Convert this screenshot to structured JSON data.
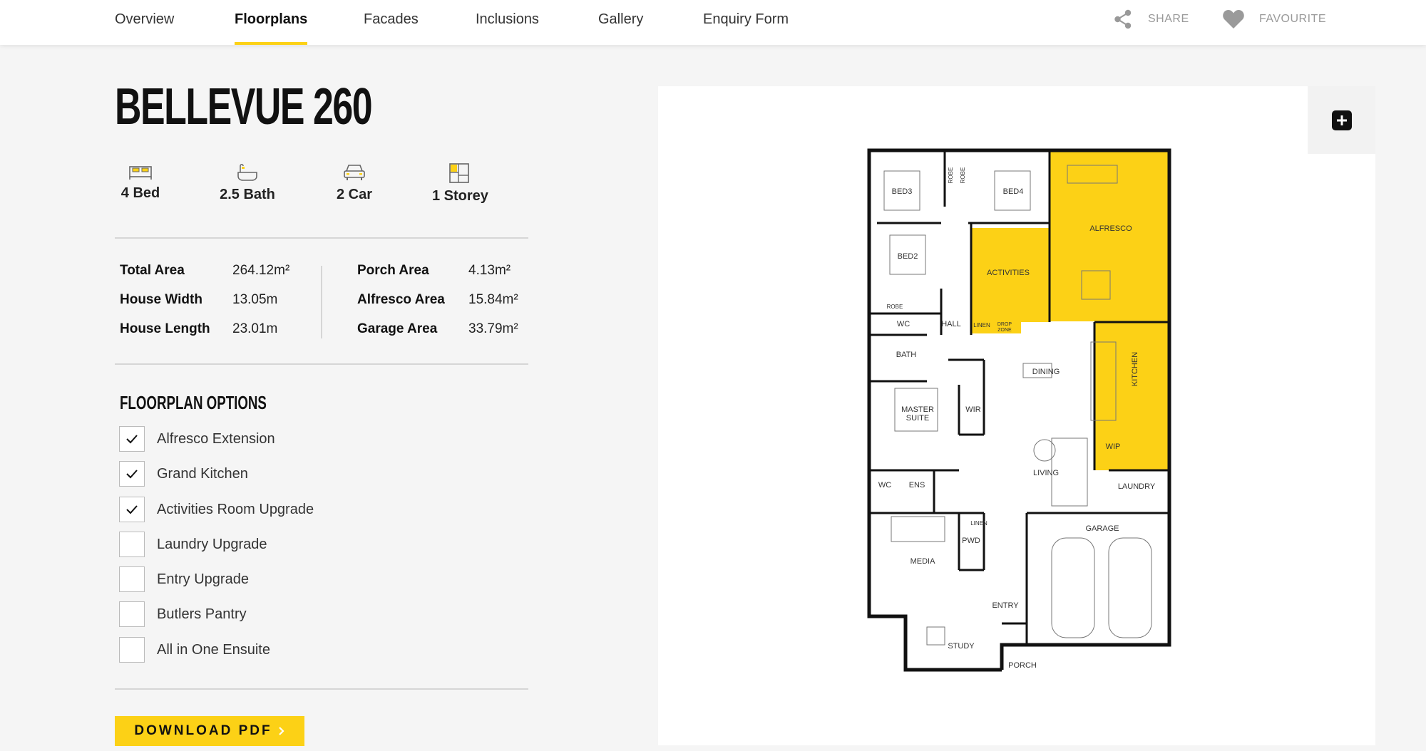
{
  "nav": {
    "tabs": [
      {
        "label": "Overview",
        "active": false
      },
      {
        "label": "Floorplans",
        "active": true
      },
      {
        "label": "Facades",
        "active": false
      },
      {
        "label": "Inclusions",
        "active": false
      },
      {
        "label": "Gallery",
        "active": false
      },
      {
        "label": "Enquiry Form",
        "active": false
      }
    ],
    "share": {
      "label": "SHARE",
      "icon": "share-icon"
    },
    "favourite": {
      "label": "FAVOURITE",
      "icon": "heart-icon"
    }
  },
  "home": {
    "title": "BELLEVUE 260",
    "specs": [
      {
        "icon": "bed-icon",
        "label": "4 Bed"
      },
      {
        "icon": "bath-icon",
        "label": "2.5 Bath"
      },
      {
        "icon": "car-icon",
        "label": "2 Car"
      },
      {
        "icon": "storey-icon",
        "label": "1 Storey"
      }
    ],
    "areas_left": [
      {
        "label": "Total Area",
        "value": "264.12m²"
      },
      {
        "label": "House Width",
        "value": "13.05m"
      },
      {
        "label": "House Length",
        "value": "23.01m"
      }
    ],
    "areas_right": [
      {
        "label": "Porch Area",
        "value": "4.13m²"
      },
      {
        "label": "Alfresco Area",
        "value": "15.84m²"
      },
      {
        "label": "Garage Area",
        "value": "33.79m²"
      }
    ]
  },
  "options": {
    "title": "FLOORPLAN OPTIONS",
    "items": [
      {
        "label": "Alfresco Extension",
        "checked": true
      },
      {
        "label": "Grand Kitchen",
        "checked": true
      },
      {
        "label": "Activities Room Upgrade",
        "checked": true
      },
      {
        "label": "Laundry Upgrade",
        "checked": false
      },
      {
        "label": "Entry Upgrade",
        "checked": false
      },
      {
        "label": "Butlers Pantry",
        "checked": false
      },
      {
        "label": "All in One Ensuite",
        "checked": false
      }
    ]
  },
  "download": {
    "label": "DOWNLOAD PDF"
  },
  "plan": {
    "highlight_color": "#fcd116",
    "zoom_icon": "plus-icon",
    "rooms": {
      "bed3": "BED3",
      "bed4": "BED4",
      "robe_a": "ROBE",
      "robe_b": "ROBE",
      "alfresco": "ALFRESCO",
      "bed2": "BED2",
      "activities": "ACTIVITIES",
      "robe_c": "ROBE",
      "wc1": "WC",
      "hall": "HALL",
      "linen1": "LINEN",
      "drop1": "DROP",
      "drop2": "ZONE",
      "bath": "BATH",
      "dining": "DINING",
      "kitchen": "KITCHEN",
      "master1": "MASTER",
      "master2": "SUITE",
      "wir": "WIR",
      "wip": "WIP",
      "living": "LIVING",
      "laundry": "LAUNDRY",
      "wc2": "WC",
      "ens": "ENS",
      "linen2": "LINEN",
      "garage": "GARAGE",
      "pwd": "PWD",
      "media": "MEDIA",
      "entry": "ENTRY",
      "study": "STUDY",
      "porch": "PORCH"
    }
  }
}
